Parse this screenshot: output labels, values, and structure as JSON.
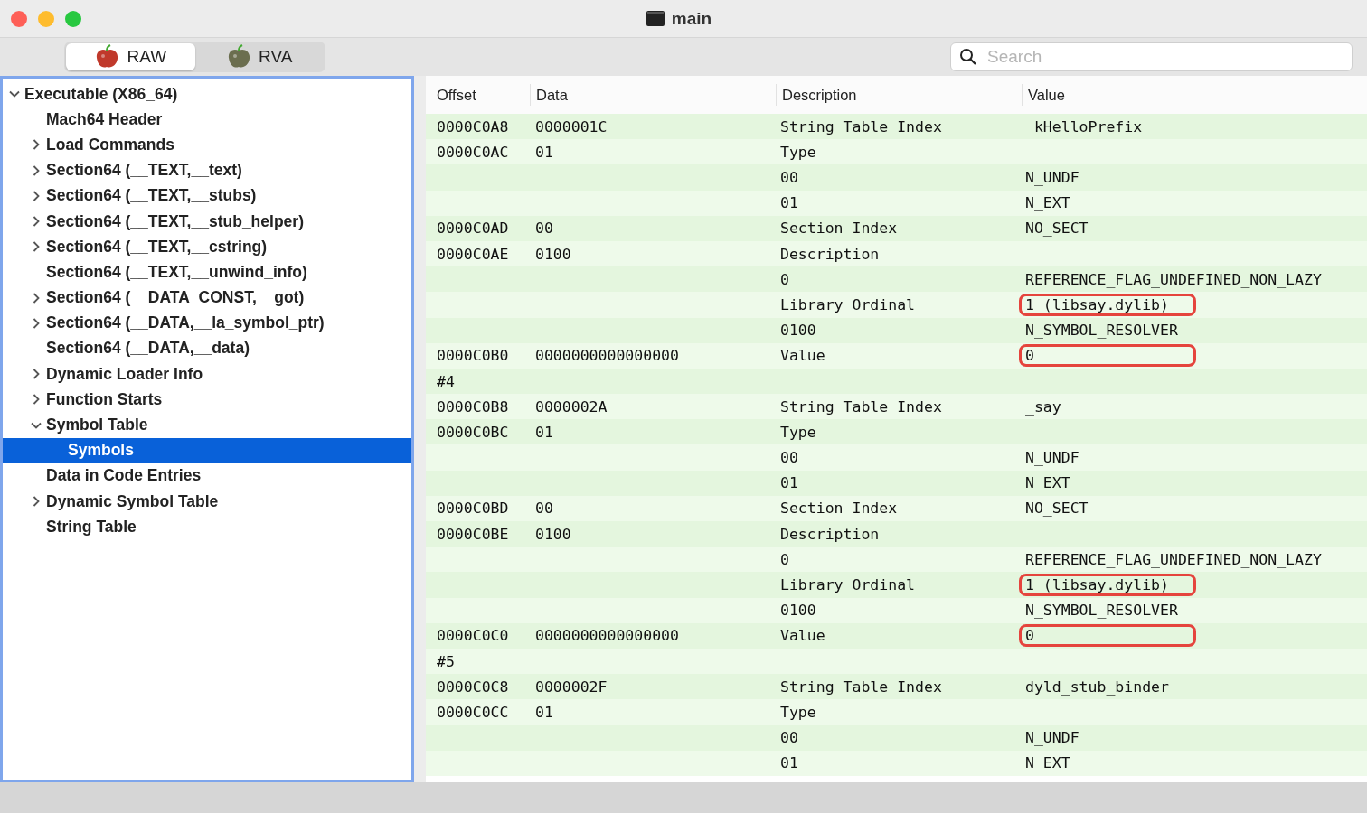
{
  "window": {
    "title": "main"
  },
  "mode_tabs": [
    {
      "label": "RAW",
      "selected": true
    },
    {
      "label": "RVA",
      "selected": false
    }
  ],
  "search": {
    "placeholder": "Search"
  },
  "sidebar": {
    "items": [
      {
        "label": "Executable  (X86_64)",
        "expanded": true,
        "selected": false,
        "children": [
          {
            "label": "Mach64 Header",
            "selected": false
          },
          {
            "label": "Load Commands",
            "expanded": false,
            "selected": false
          },
          {
            "label": "Section64 (__TEXT,__text)",
            "expanded": false,
            "selected": false
          },
          {
            "label": "Section64 (__TEXT,__stubs)",
            "expanded": false,
            "selected": false
          },
          {
            "label": "Section64 (__TEXT,__stub_helper)",
            "expanded": false,
            "selected": false
          },
          {
            "label": "Section64 (__TEXT,__cstring)",
            "expanded": false,
            "selected": false
          },
          {
            "label": "Section64 (__TEXT,__unwind_info)",
            "selected": false
          },
          {
            "label": "Section64 (__DATA_CONST,__got)",
            "expanded": false,
            "selected": false
          },
          {
            "label": "Section64 (__DATA,__la_symbol_ptr)",
            "expanded": false,
            "selected": false
          },
          {
            "label": "Section64 (__DATA,__data)",
            "selected": false
          },
          {
            "label": "Dynamic Loader Info",
            "expanded": false,
            "selected": false
          },
          {
            "label": "Function Starts",
            "expanded": false,
            "selected": false
          },
          {
            "label": "Symbol Table",
            "expanded": true,
            "selected": false,
            "children": [
              {
                "label": "Symbols",
                "selected": true
              }
            ]
          },
          {
            "label": "Data in Code Entries",
            "selected": false
          },
          {
            "label": "Dynamic Symbol Table",
            "expanded": false,
            "selected": false
          },
          {
            "label": "String Table",
            "selected": false
          }
        ]
      }
    ]
  },
  "table": {
    "columns": [
      "Offset",
      "Data",
      "Description",
      "Value"
    ],
    "rows": [
      {
        "kind": "field",
        "offset": "0000C0A8",
        "data": "0000001C",
        "description": "String Table Index",
        "value": "_kHelloPrefix",
        "highlighted": false
      },
      {
        "kind": "field",
        "offset": "0000C0AC",
        "data": "01",
        "description": "Type",
        "value": "",
        "highlighted": false
      },
      {
        "kind": "field",
        "offset": "",
        "data": "",
        "description": "00",
        "value": "N_UNDF",
        "highlighted": false
      },
      {
        "kind": "field",
        "offset": "",
        "data": "",
        "description": "01",
        "value": "N_EXT",
        "highlighted": false
      },
      {
        "kind": "field",
        "offset": "0000C0AD",
        "data": "00",
        "description": "Section Index",
        "value": "NO_SECT",
        "highlighted": false
      },
      {
        "kind": "field",
        "offset": "0000C0AE",
        "data": "0100",
        "description": "Description",
        "value": "",
        "highlighted": false
      },
      {
        "kind": "field",
        "offset": "",
        "data": "",
        "description": "0",
        "value": "REFERENCE_FLAG_UNDEFINED_NON_LAZY",
        "highlighted": false
      },
      {
        "kind": "field",
        "offset": "",
        "data": "",
        "description": "Library Ordinal",
        "value": "1 (libsay.dylib)",
        "highlighted": true
      },
      {
        "kind": "field",
        "offset": "",
        "data": "",
        "description": "0100",
        "value": "N_SYMBOL_RESOLVER",
        "highlighted": false
      },
      {
        "kind": "field",
        "offset": "0000C0B0",
        "data": "0000000000000000",
        "description": "Value",
        "value": "0",
        "highlighted": true
      },
      {
        "kind": "group",
        "label": "#4"
      },
      {
        "kind": "field",
        "offset": "0000C0B8",
        "data": "0000002A",
        "description": "String Table Index",
        "value": "_say",
        "highlighted": false
      },
      {
        "kind": "field",
        "offset": "0000C0BC",
        "data": "01",
        "description": "Type",
        "value": "",
        "highlighted": false
      },
      {
        "kind": "field",
        "offset": "",
        "data": "",
        "description": "00",
        "value": "N_UNDF",
        "highlighted": false
      },
      {
        "kind": "field",
        "offset": "",
        "data": "",
        "description": "01",
        "value": "N_EXT",
        "highlighted": false
      },
      {
        "kind": "field",
        "offset": "0000C0BD",
        "data": "00",
        "description": "Section Index",
        "value": "NO_SECT",
        "highlighted": false
      },
      {
        "kind": "field",
        "offset": "0000C0BE",
        "data": "0100",
        "description": "Description",
        "value": "",
        "highlighted": false
      },
      {
        "kind": "field",
        "offset": "",
        "data": "",
        "description": "0",
        "value": "REFERENCE_FLAG_UNDEFINED_NON_LAZY",
        "highlighted": false
      },
      {
        "kind": "field",
        "offset": "",
        "data": "",
        "description": "Library Ordinal",
        "value": "1 (libsay.dylib)",
        "highlighted": true
      },
      {
        "kind": "field",
        "offset": "",
        "data": "",
        "description": "0100",
        "value": "N_SYMBOL_RESOLVER",
        "highlighted": false
      },
      {
        "kind": "field",
        "offset": "0000C0C0",
        "data": "0000000000000000",
        "description": "Value",
        "value": "0",
        "highlighted": true
      },
      {
        "kind": "group",
        "label": "#5"
      },
      {
        "kind": "field",
        "offset": "0000C0C8",
        "data": "0000002F",
        "description": "String Table Index",
        "value": "dyld_stub_binder",
        "highlighted": false
      },
      {
        "kind": "field",
        "offset": "0000C0CC",
        "data": "01",
        "description": "Type",
        "value": "",
        "highlighted": false
      },
      {
        "kind": "field",
        "offset": "",
        "data": "",
        "description": "00",
        "value": "N_UNDF",
        "highlighted": false
      },
      {
        "kind": "field",
        "offset": "",
        "data": "",
        "description": "01",
        "value": "N_EXT",
        "highlighted": false
      }
    ]
  }
}
